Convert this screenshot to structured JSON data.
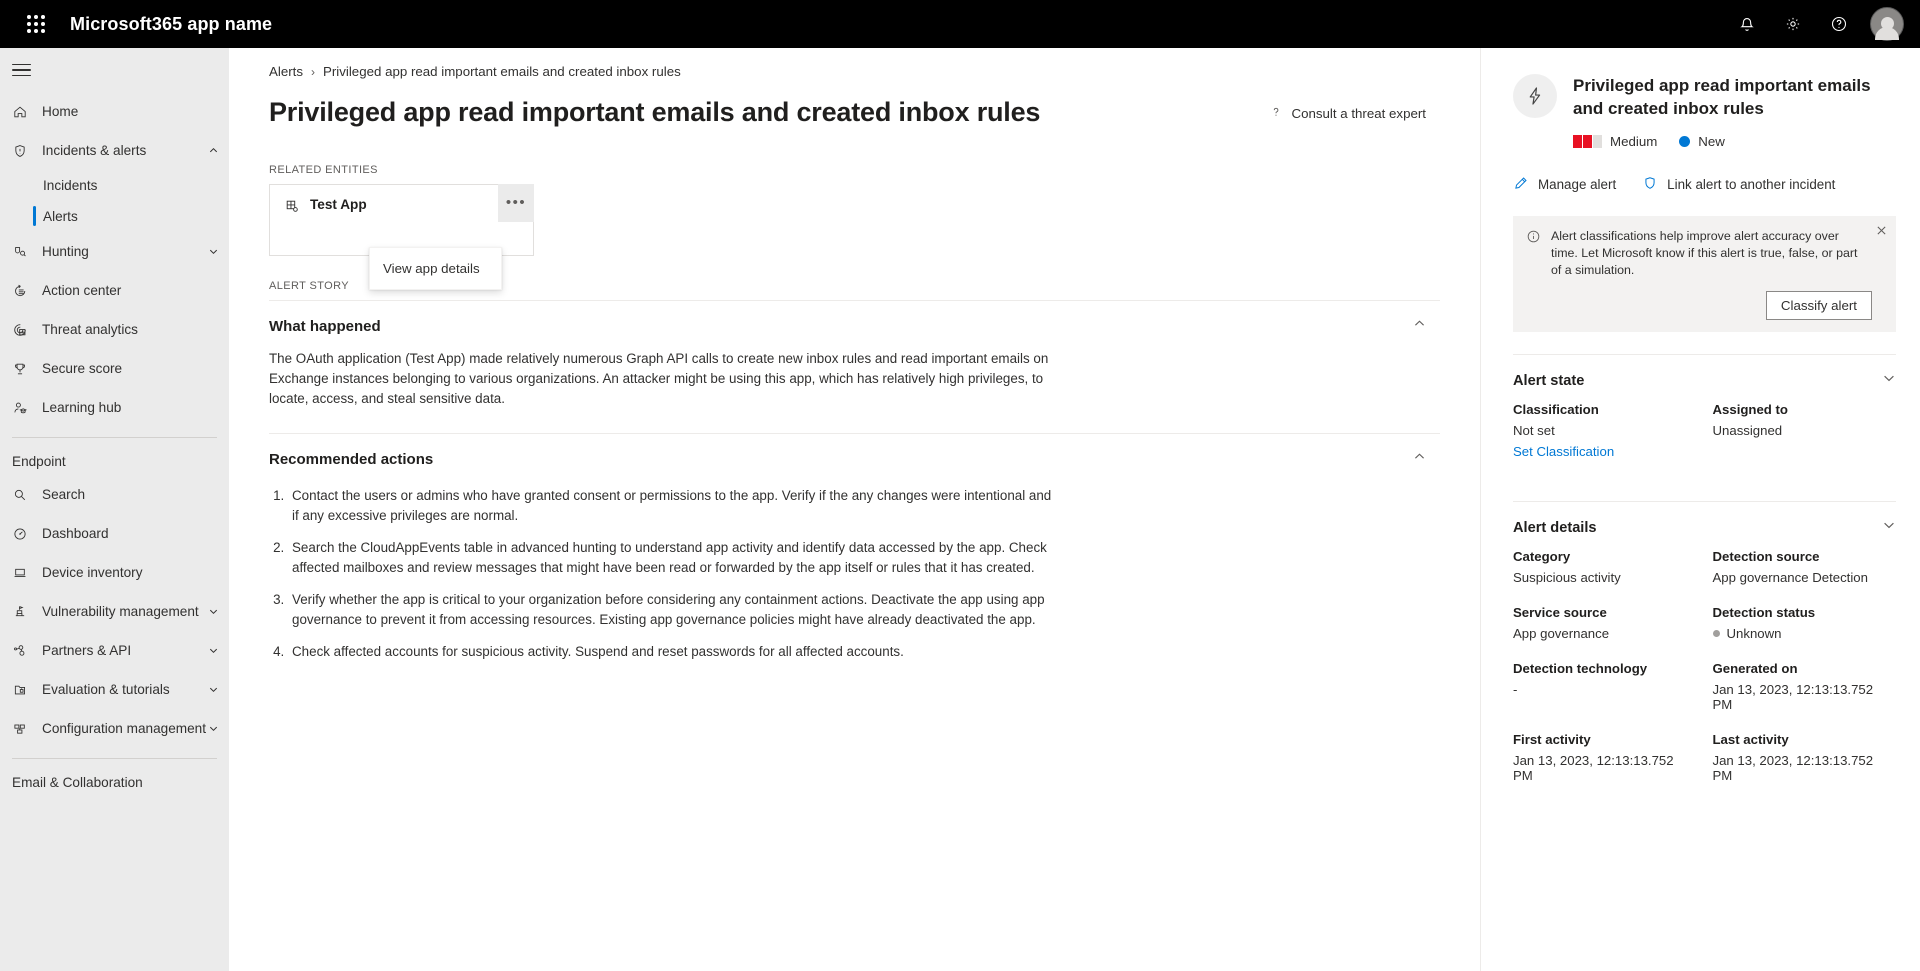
{
  "suite": {
    "title": "Microsoft365 app name",
    "waffle_icon": "app-launcher-icon",
    "notifications_icon": "bell-icon",
    "settings_icon": "gear-icon",
    "help_icon": "help-icon",
    "avatar_icon": "account-avatar"
  },
  "sidebar": {
    "hamburger_icon": "hamburger-icon",
    "items": [
      {
        "label": "Home",
        "icon": "home-icon",
        "type": "item"
      },
      {
        "label": "Incidents & alerts",
        "icon": "shield-icon",
        "type": "expandable",
        "expanded": true
      },
      {
        "label": "Incidents",
        "type": "sub"
      },
      {
        "label": "Alerts",
        "type": "sub",
        "selected": true
      },
      {
        "label": "Hunting",
        "icon": "hunting-icon",
        "type": "expandable",
        "expanded": false
      },
      {
        "label": "Action center",
        "icon": "action-center-icon",
        "type": "item"
      },
      {
        "label": "Threat analytics",
        "icon": "threat-analytics-icon",
        "type": "item"
      },
      {
        "label": "Secure score",
        "icon": "trophy-icon",
        "type": "item"
      },
      {
        "label": "Learning hub",
        "icon": "learning-hub-icon",
        "type": "item"
      }
    ],
    "section_endpoint": "Endpoint",
    "endpoint_items": [
      {
        "label": "Search",
        "icon": "search-icon",
        "type": "item"
      },
      {
        "label": "Dashboard",
        "icon": "dashboard-icon",
        "type": "item"
      },
      {
        "label": "Device inventory",
        "icon": "device-icon",
        "type": "item"
      },
      {
        "label": "Vulnerability management",
        "icon": "vulnerability-icon",
        "type": "expandable"
      },
      {
        "label": "Partners & API",
        "icon": "partners-api-icon",
        "type": "expandable"
      },
      {
        "label": "Evaluation & tutorials",
        "icon": "evaluation-icon",
        "type": "expandable"
      },
      {
        "label": "Configuration management",
        "icon": "configuration-icon",
        "type": "expandable"
      }
    ],
    "section_email": "Email & Collaboration"
  },
  "breadcrumb": {
    "parent": "Alerts",
    "separator": "›",
    "current": "Privileged app read important emails and created inbox rules"
  },
  "page": {
    "title": "Privileged app read important emails and created inbox rules",
    "consult_label": "Consult a threat expert",
    "consult_icon": "question-icon"
  },
  "related_entities": {
    "caption": "RELATED ENTITIES",
    "entity_name": "Test App",
    "entity_icon": "app-entity-icon",
    "ellipsis_label": "•••",
    "menu": {
      "items": [
        "View app details"
      ]
    }
  },
  "alert_story": {
    "caption": "ALERT STORY",
    "what_happened": {
      "title": "What happened",
      "chevron": "chevron-up-icon",
      "text": "The OAuth application (Test App) made relatively numerous Graph API calls to create new inbox rules and read important emails on Exchange instances belonging to various organizations. An attacker might be using this app, which has relatively high privileges, to locate, access, and steal sensitive data."
    },
    "recommended_actions": {
      "title": "Recommended actions",
      "chevron": "chevron-up-icon",
      "items": [
        "Contact the users or admins who have granted consent or permissions to the app. Verify if the any changes were intentional and if any excessive privileges are normal.",
        "Search the CloudAppEvents table in advanced hunting to understand app activity and identify data accessed by the app. Check affected mailboxes and review messages that might have been read or forwarded by the app itself or rules that it has created.",
        "Verify whether the app is critical to your organization before considering any containment actions. Deactivate the app using app governance to prevent it from accessing resources. Existing app governance policies might have already deactivated the app.",
        "Check affected accounts for suspicious activity. Suspend and reset passwords for all affected accounts."
      ]
    }
  },
  "right_panel": {
    "icon": "lightning-bolt-icon",
    "title": "Privileged app read important emails and created inbox rules",
    "severity": {
      "label": "Medium",
      "filled_bars": 2,
      "total_bars": 3,
      "color": "#e81123",
      "empty_color": "#e1dfdd"
    },
    "status": {
      "label": "New",
      "color": "#0078d4"
    },
    "actions": [
      {
        "label": "Manage alert",
        "icon": "pencil-icon",
        "color": "#0078d4"
      },
      {
        "label": "Link alert to another incident",
        "icon": "shield-link-icon",
        "color": "#0078d4"
      }
    ],
    "notice": {
      "icon": "info-icon",
      "text": "Alert classifications help improve alert accuracy over time. Let Microsoft know if this alert is true, false, or part of a simulation.",
      "button_label": "Classify alert",
      "close_icon": "close-icon"
    },
    "alert_state": {
      "title": "Alert state",
      "chevron": "chevron-down-icon",
      "fields": [
        {
          "label": "Classification",
          "value": "Not set",
          "link": "Set Classification"
        },
        {
          "label": "Assigned to",
          "value": "Unassigned"
        }
      ]
    },
    "alert_details": {
      "title": "Alert details",
      "chevron": "chevron-down-icon",
      "fields": [
        {
          "label": "Category",
          "value": "Suspicious activity"
        },
        {
          "label": "Detection source",
          "value": "App governance Detection"
        },
        {
          "label": "Service source",
          "value": "App governance"
        },
        {
          "label": "Detection status",
          "value": "Unknown",
          "dot": "#a19f9d"
        },
        {
          "label": "Detection technology",
          "value": "-"
        },
        {
          "label": "Generated on",
          "value": "Jan 13, 2023, 12:13:13.752 PM"
        },
        {
          "label": "First activity",
          "value": "Jan 13, 2023, 12:13:13.752 PM"
        },
        {
          "label": "Last activity",
          "value": "Jan 13, 2023, 12:13:13.752 PM"
        }
      ]
    }
  }
}
